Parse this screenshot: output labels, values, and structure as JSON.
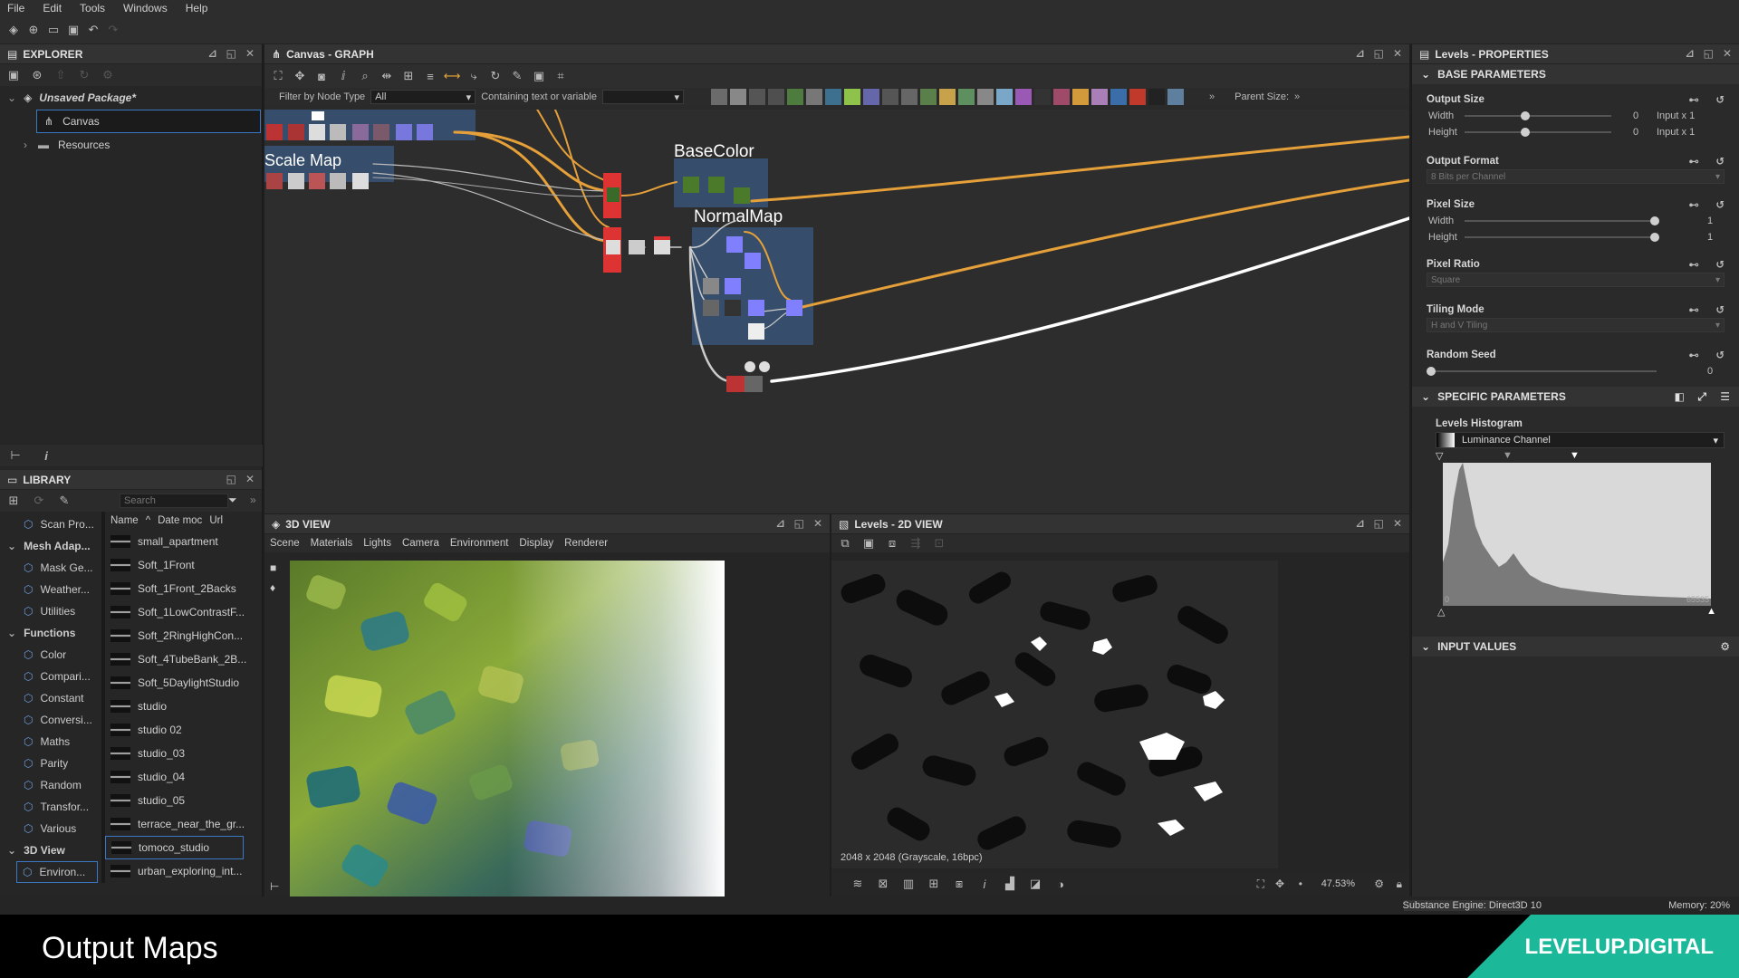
{
  "menu": [
    "File",
    "Edit",
    "Tools",
    "Windows",
    "Help"
  ],
  "explorer": {
    "title": "EXPLORER",
    "package": "Unsaved Package*",
    "items": [
      {
        "label": "Canvas",
        "selected": true
      },
      {
        "label": "Resources",
        "selected": false
      }
    ]
  },
  "graph": {
    "title": "Canvas - GRAPH",
    "filter_label": "Filter by Node Type",
    "filter_value": "All",
    "containing_label": "Containing text or variable",
    "parent_size_label": "Parent Size:",
    "frames": [
      "Scale Map",
      "BaseColor",
      "NormalMap"
    ]
  },
  "properties": {
    "title": "Levels - PROPERTIES",
    "base_section": "BASE PARAMETERS",
    "output_size": {
      "label": "Output Size",
      "width_label": "Width",
      "width_value": "0",
      "width_mode": "Input x 1",
      "height_label": "Height",
      "height_value": "0",
      "height_mode": "Input x 1"
    },
    "output_format": {
      "label": "Output Format",
      "value": "8 Bits per Channel"
    },
    "pixel_size": {
      "label": "Pixel Size",
      "width_label": "Width",
      "width_value": "1",
      "height_label": "Height",
      "height_value": "1"
    },
    "pixel_ratio": {
      "label": "Pixel Ratio",
      "value": "Square"
    },
    "tiling_mode": {
      "label": "Tiling Mode",
      "value": "H and V Tiling"
    },
    "random_seed": {
      "label": "Random Seed",
      "value": "0"
    },
    "specific_section": "SPECIFIC PARAMETERS",
    "levels_histogram": {
      "label": "Levels Histogram",
      "channel": "Luminance Channel",
      "min_label": "0",
      "max_label": "65535"
    },
    "input_section": "INPUT VALUES"
  },
  "library": {
    "title": "LIBRARY",
    "search_placeholder": "Search",
    "columns": [
      "Name",
      "Date moc",
      "Url"
    ],
    "categories": [
      {
        "label": "Scan Pro...",
        "type": "item"
      },
      {
        "label": "Mesh Adap...",
        "type": "header"
      },
      {
        "label": "Mask Ge...",
        "type": "item"
      },
      {
        "label": "Weather...",
        "type": "item"
      },
      {
        "label": "Utilities",
        "type": "item"
      },
      {
        "label": "Functions",
        "type": "header"
      },
      {
        "label": "Color",
        "type": "item"
      },
      {
        "label": "Compari...",
        "type": "item"
      },
      {
        "label": "Constant",
        "type": "item"
      },
      {
        "label": "Conversi...",
        "type": "item"
      },
      {
        "label": "Maths",
        "type": "item"
      },
      {
        "label": "Parity",
        "type": "item"
      },
      {
        "label": "Random",
        "type": "item"
      },
      {
        "label": "Transfor...",
        "type": "item"
      },
      {
        "label": "Various",
        "type": "item"
      },
      {
        "label": "3D View",
        "type": "header"
      },
      {
        "label": "Environ...",
        "type": "selected"
      }
    ],
    "files": [
      {
        "label": "small_apartment"
      },
      {
        "label": "Soft_1Front"
      },
      {
        "label": "Soft_1Front_2Backs"
      },
      {
        "label": "Soft_1LowContrastF..."
      },
      {
        "label": "Soft_2RingHighCon..."
      },
      {
        "label": "Soft_4TubeBank_2B..."
      },
      {
        "label": "Soft_5DaylightStudio"
      },
      {
        "label": "studio"
      },
      {
        "label": "studio 02"
      },
      {
        "label": "studio_03"
      },
      {
        "label": "studio_04"
      },
      {
        "label": "studio_05"
      },
      {
        "label": "terrace_near_the_gr..."
      },
      {
        "label": "tomoco_studio",
        "selected": true
      },
      {
        "label": "urban_exploring_int..."
      }
    ]
  },
  "view3d": {
    "title": "3D VIEW",
    "menu": [
      "Scene",
      "Materials",
      "Lights",
      "Camera",
      "Environment",
      "Display",
      "Renderer"
    ]
  },
  "view2d": {
    "title": "Levels - 2D VIEW",
    "info": "2048 x 2048 (Grayscale, 16bpc)",
    "zoom": "47.53%"
  },
  "status": {
    "engine": "Substance Engine: Direct3D 10",
    "memory": "Memory: 20%"
  },
  "banner": {
    "title": "Output Maps",
    "brand": "LEVELUP.DIGITAL"
  },
  "histogram": {
    "min": 0,
    "mid": 0.25,
    "max": 0.5
  }
}
